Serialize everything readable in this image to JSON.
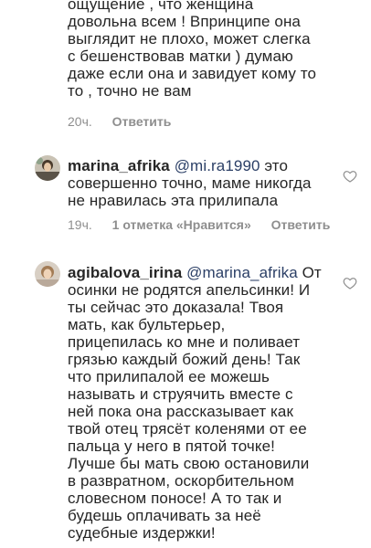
{
  "comment_top": {
    "lines": [
      "ощущение , что женщина",
      "довольна всем !  Впринципе она",
      "выглядит не плохо, может слегка",
      "с бешенствовав матки ) думаю",
      "даже если она и завидует кому то",
      "то , точно не вам"
    ],
    "time": "20ч.",
    "reply": "Ответить"
  },
  "comment_marina": {
    "username": "marina_afrika",
    "mention": "@mi.ra1990",
    "line1_rest": " это",
    "lines": [
      "совершенно точно, маме никогда",
      "не нравилась эта прилипала"
    ],
    "time": "19ч.",
    "likes": "1 отметка «Нравится»",
    "reply": "Ответить"
  },
  "comment_agibalova": {
    "username": "agibalova_irina",
    "mention": "@marina_afrika",
    "line1_rest": " От",
    "lines": [
      "осинки не родятся апельсинки! И",
      "ты сейчас это доказала! Твоя",
      "мать, как бультерьер,",
      "прицепилась ко мне и поливает",
      "грязью каждый божий день! Так",
      "что прилипалой ее можешь",
      "называть и струячить вместе с",
      "ней пока она рассказывает как",
      "твой отец трясёт коленями от ее",
      "пальца у него в пятой точке!",
      "Лучше бы мать свою остановили",
      "в развратном, оскорбительном",
      "словесном поносе! А то так и",
      "будешь оплачивать за неё",
      "судебные издержки!"
    ]
  },
  "icons": {
    "avatar_marina": "avatar",
    "avatar_agibalova": "avatar",
    "like": "heart-icon"
  },
  "colors": {
    "text": "#262626",
    "meta": "#8e8e8e",
    "mention": "#2b3f66"
  }
}
